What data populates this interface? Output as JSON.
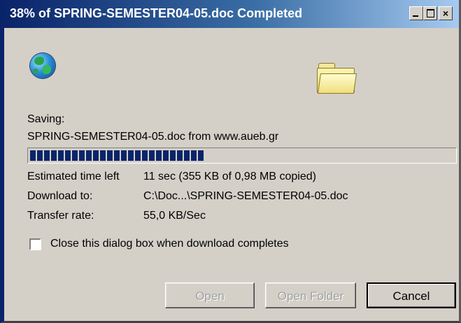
{
  "window": {
    "title": "38% of SPRING-SEMESTER04-05.doc Completed",
    "progress_fraction": 0.38,
    "progress_chunks": 25
  },
  "icons": {
    "globe": "globe-icon",
    "folder": "folder-icon",
    "minimize": "minimize-icon",
    "maximize": "maximize-icon",
    "close": "close-icon"
  },
  "status": {
    "saving_label": "Saving:",
    "saving_file": "SPRING-SEMESTER04-05.doc from www.aueb.gr",
    "time_left_label": "Estimated time left",
    "time_left_value": "11 sec (355 KB of 0,98 MB copied)",
    "download_to_label": "Download to:",
    "download_to_value": "C:\\Doc...\\SPRING-SEMESTER04-05.doc",
    "transfer_rate_label": "Transfer rate:",
    "transfer_rate_value": "55,0 KB/Sec"
  },
  "options": {
    "close_when_done_label": "Close this dialog box when download completes",
    "close_when_done_checked": false
  },
  "buttons": {
    "open": "Open",
    "open_folder": "Open Folder",
    "cancel": "Cancel",
    "close_glyph": "×"
  },
  "colors": {
    "title_start": "#0a246a",
    "title_end": "#a6caf0",
    "progress": "#0a246a",
    "face": "#d4d0c8"
  }
}
